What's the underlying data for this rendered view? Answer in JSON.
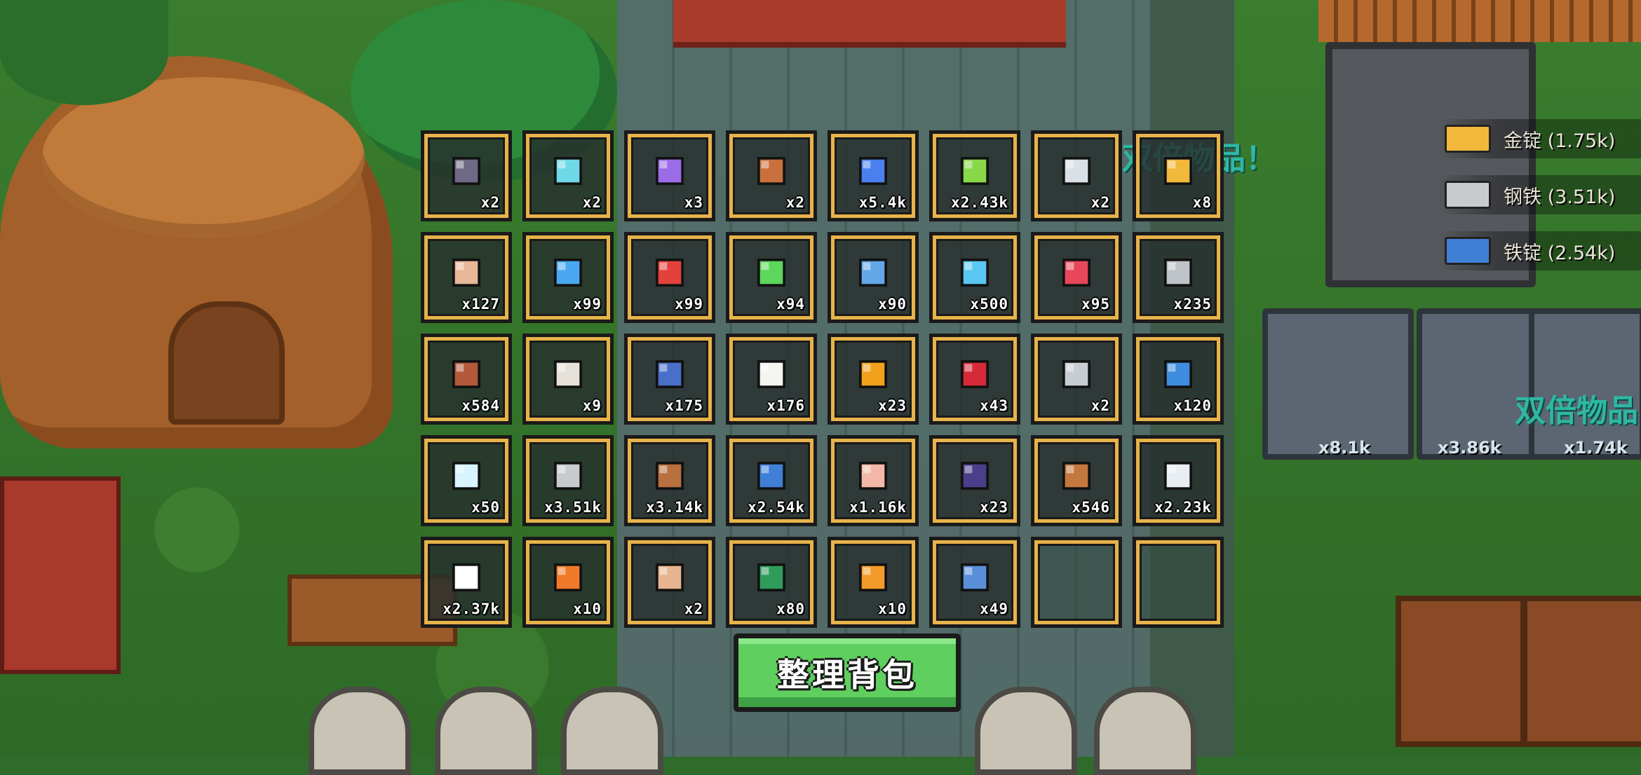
{
  "inventory": {
    "items": [
      {
        "name": "stone-ore-icon",
        "qty": "x2",
        "color": "#6e6a86"
      },
      {
        "name": "crystal-shard-icon",
        "qty": "x2",
        "color": "#6fd8e6"
      },
      {
        "name": "purple-crystal-icon",
        "qty": "x3",
        "color": "#9b6be8"
      },
      {
        "name": "leather-bag-icon",
        "qty": "x2",
        "color": "#c9703d"
      },
      {
        "name": "slime-orb-icon",
        "qty": "x5.4k",
        "color": "#4a7ff0"
      },
      {
        "name": "green-slime-block-icon",
        "qty": "x2.43k",
        "color": "#88d84a"
      },
      {
        "name": "glass-jar-icon",
        "qty": "x2",
        "color": "#d9e1e6"
      },
      {
        "name": "golden-ring-icon",
        "qty": "x8",
        "color": "#f0b93a"
      },
      {
        "name": "scroll-icon",
        "qty": "x127",
        "color": "#e8b89a"
      },
      {
        "name": "blue-potion-icon",
        "qty": "x99",
        "color": "#4aa8f0"
      },
      {
        "name": "red-potion-icon",
        "qty": "x99",
        "color": "#e2423b"
      },
      {
        "name": "green-potion-icon",
        "qty": "x94",
        "color": "#5cd65c"
      },
      {
        "name": "water-flask-icon",
        "qty": "x90",
        "color": "#63a7e8"
      },
      {
        "name": "mana-potion-icon",
        "qty": "x500",
        "color": "#59c7f2"
      },
      {
        "name": "health-potion-icon",
        "qty": "x95",
        "color": "#e8475a"
      },
      {
        "name": "slime-gem-ore-icon",
        "qty": "x235",
        "color": "#bfc4c8"
      },
      {
        "name": "meat-icon",
        "qty": "x584",
        "color": "#b25a3a"
      },
      {
        "name": "bone-fish-icon",
        "qty": "x9",
        "color": "#e6e2da"
      },
      {
        "name": "blue-fish-icon",
        "qty": "x175",
        "color": "#4a6fc9"
      },
      {
        "name": "egg-icon",
        "qty": "x176",
        "color": "#f5f5f0"
      },
      {
        "name": "orange-fruit-icon",
        "qty": "x23",
        "color": "#f2a11d"
      },
      {
        "name": "red-berries-icon",
        "qty": "x43",
        "color": "#d62a3a"
      },
      {
        "name": "steel-roll-icon",
        "qty": "x2",
        "color": "#c7cdd3"
      },
      {
        "name": "blue-log-icon",
        "qty": "x120",
        "color": "#3e8de0"
      },
      {
        "name": "ice-crystal-icon",
        "qty": "x50",
        "color": "#d8f4ff"
      },
      {
        "name": "steel-ingot-icon",
        "qty": "x3.51k",
        "color": "#c8cbce"
      },
      {
        "name": "clay-lump-icon",
        "qty": "x3.14k",
        "color": "#b8703e"
      },
      {
        "name": "iron-ingot-icon",
        "qty": "x2.54k",
        "color": "#3f7fd6"
      },
      {
        "name": "pink-dough-icon",
        "qty": "x1.16k",
        "color": "#f3b8a8"
      },
      {
        "name": "dark-flower-icon",
        "qty": "x23",
        "color": "#4a3f8a"
      },
      {
        "name": "dirt-pile-icon",
        "qty": "x546",
        "color": "#c4783d"
      },
      {
        "name": "cotton-icon",
        "qty": "x2.23k",
        "color": "#e8eef2"
      },
      {
        "name": "white-flower-icon",
        "qty": "x2.37k",
        "color": "#ffffff"
      },
      {
        "name": "pumpkin-icon",
        "qty": "x10",
        "color": "#f07a2a"
      },
      {
        "name": "house-blueprint-icon",
        "qty": "x2",
        "color": "#e6b490"
      },
      {
        "name": "green-vine-icon",
        "qty": "x80",
        "color": "#2f9c5a"
      },
      {
        "name": "wheat-bundle-icon",
        "qty": "x10",
        "color": "#f29a2a"
      },
      {
        "name": "blue-ore-icon",
        "qty": "x49",
        "color": "#5a8fd8"
      },
      {
        "name": "empty-slot",
        "qty": "",
        "color": ""
      },
      {
        "name": "empty-slot",
        "qty": "",
        "color": ""
      }
    ]
  },
  "sort_button": {
    "label": "整理背包"
  },
  "resources": [
    {
      "name": "gold-ingot-icon",
      "text": "金锭 (1.75k)",
      "color": "#f2b83a"
    },
    {
      "name": "steel-icon",
      "text": "钢铁 (3.51k)",
      "color": "#c8cbce"
    },
    {
      "name": "iron-ingot-icon",
      "text": "铁锭 (2.54k)",
      "color": "#3f7fd6"
    }
  ],
  "world": {
    "banner_text": "双倍物品！",
    "banner_text_2": "双倍物品",
    "machine_counts": [
      "x8.1k",
      "x3.86k",
      "x1.74k"
    ]
  }
}
